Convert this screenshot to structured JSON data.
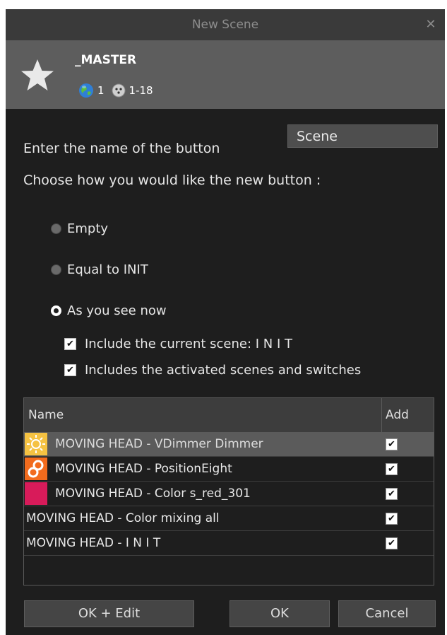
{
  "window": {
    "title": "New Scene",
    "close_symbol": "✕"
  },
  "header": {
    "master_name": "_MASTER",
    "universe": "1",
    "channels": "1-18"
  },
  "form": {
    "name_prompt": "Enter the name of the button",
    "name_value": "Scene",
    "choose_prompt": "Choose how you would like the new button :"
  },
  "options": [
    {
      "label": "Empty",
      "selected": false
    },
    {
      "label": "Equal to INIT",
      "selected": false
    },
    {
      "label": "As you see now",
      "selected": true
    }
  ],
  "checkboxes": [
    {
      "label": "Include the current scene: I N I T",
      "checked": true
    },
    {
      "label": "Includes the activated scenes and switches",
      "checked": true
    }
  ],
  "table": {
    "columns": [
      "Name",
      "Add"
    ],
    "rows": [
      {
        "name": "MOVING HEAD - VDimmer Dimmer",
        "icon": "dimmer-icon",
        "icon_color": "#f5c242",
        "add": true,
        "selected": true
      },
      {
        "name": "MOVING HEAD - PositionEight",
        "icon": "position-icon",
        "icon_color": "#f26b1d",
        "add": true,
        "selected": false
      },
      {
        "name": "MOVING HEAD - Color s_red_301",
        "icon": "color-swatch-icon",
        "icon_color": "#d81b5a",
        "add": true,
        "selected": false
      },
      {
        "name": "MOVING HEAD - Color mixing all",
        "icon": "",
        "add": true,
        "selected": false
      },
      {
        "name": "MOVING HEAD - I N I T",
        "icon": "",
        "add": true,
        "selected": false
      }
    ]
  },
  "buttons": {
    "ok_edit": "OK + Edit",
    "ok": "OK",
    "cancel": "Cancel"
  },
  "colors": {
    "background": "#1e1e1e",
    "titlebar": "#3a3a3a",
    "header": "#5d5d5d",
    "selected_row": "#5b5b5b"
  }
}
